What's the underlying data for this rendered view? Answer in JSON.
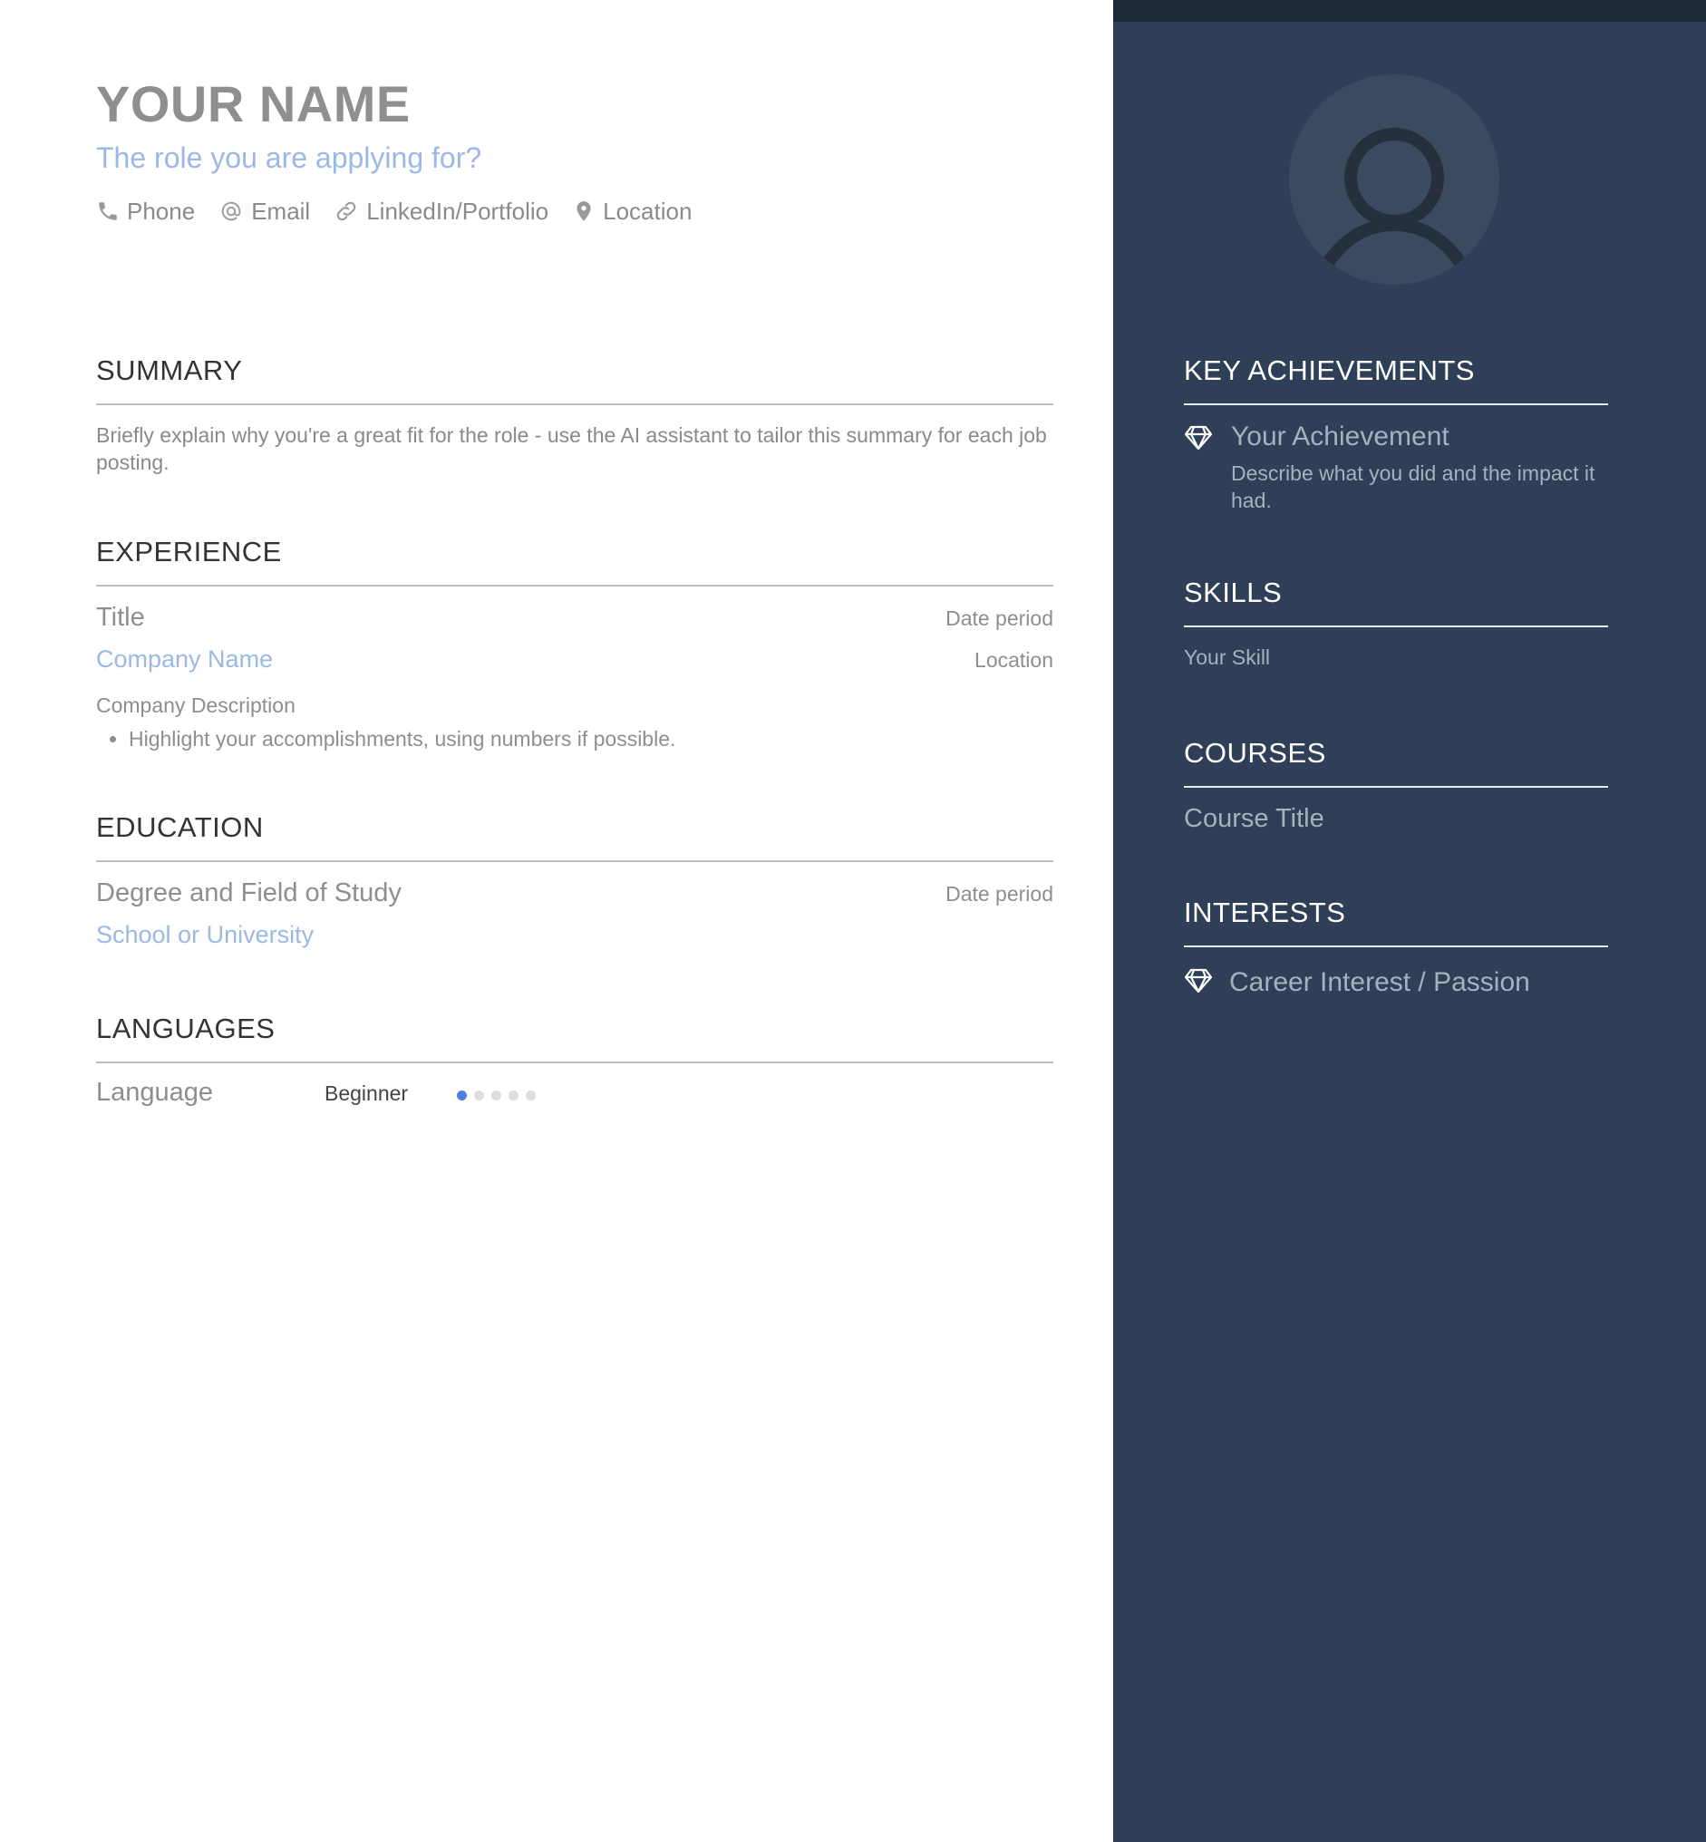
{
  "header": {
    "name": "YOUR NAME",
    "role": "The role you are applying for?",
    "contacts": [
      {
        "icon": "phone-icon",
        "label": "Phone"
      },
      {
        "icon": "at-icon",
        "label": "Email"
      },
      {
        "icon": "link-icon",
        "label": "LinkedIn/Portfolio"
      },
      {
        "icon": "location-pin-icon",
        "label": "Location"
      }
    ]
  },
  "summary": {
    "title": "SUMMARY",
    "text": "Briefly explain why you're a great fit for the role - use the AI assistant to tailor this summary for each job posting."
  },
  "experience": {
    "title": "EXPERIENCE",
    "entry": {
      "title": "Title",
      "date": "Date period",
      "company": "Company Name",
      "location": "Location",
      "description": "Company Description",
      "bullets": [
        "Highlight your accomplishments, using numbers if possible."
      ]
    }
  },
  "education": {
    "title": "EDUCATION",
    "entry": {
      "degree": "Degree and Field of Study",
      "date": "Date period",
      "school": "School or University"
    }
  },
  "languages": {
    "title": "LANGUAGES",
    "items": [
      {
        "name": "Language",
        "level": "Beginner",
        "rating": 1,
        "max": 5
      }
    ]
  },
  "sidebar": {
    "achievements": {
      "title": "KEY ACHIEVEMENTS",
      "items": [
        {
          "icon": "diamond-icon",
          "title": "Your Achievement",
          "description": "Describe what you did and the impact it had."
        }
      ]
    },
    "skills": {
      "title": "SKILLS",
      "items": [
        "Your Skill"
      ]
    },
    "courses": {
      "title": "COURSES",
      "items": [
        "Course Title"
      ]
    },
    "interests": {
      "title": "INTERESTS",
      "items": [
        {
          "icon": "diamond-icon",
          "label": "Career Interest / Passion"
        }
      ]
    }
  },
  "colors": {
    "sidebar_bg": "#2e3f57",
    "sidebar_topbar": "#1f2a3a",
    "accent_blue": "#9bb8e6",
    "dot_active": "#4b7fe0",
    "dot_inactive": "#dedede"
  }
}
